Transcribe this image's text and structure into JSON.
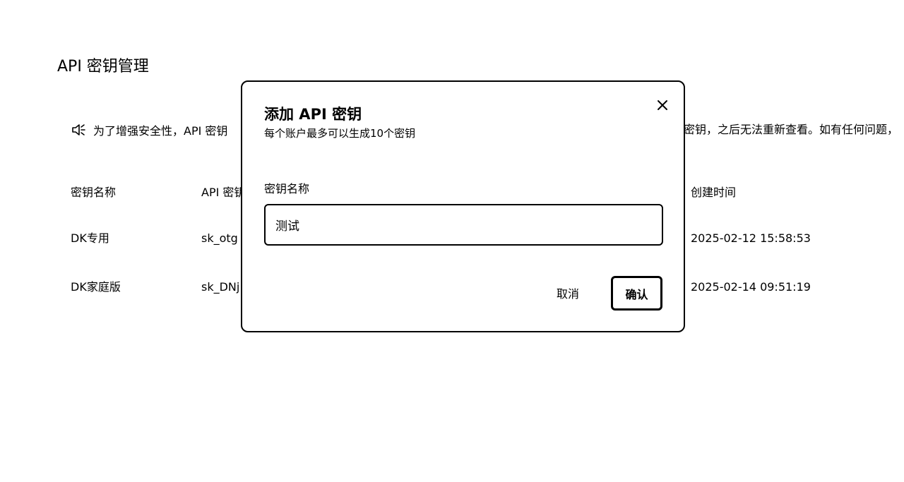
{
  "page": {
    "title": "API 密钥管理"
  },
  "notice": {
    "icon": "speaker-icon",
    "text_left": "为了增强安全性，API 密钥",
    "text_right": "密钥，之后无法重新查看。如有任何问题，"
  },
  "table": {
    "headers": {
      "name": "密钥名称",
      "key": "API 密钥",
      "created": "创建时间"
    },
    "rows": [
      {
        "name": "DK专用",
        "key": "sk_otg",
        "created": "2025-02-12 15:58:53"
      },
      {
        "name": "DK家庭版",
        "key": "sk_DNj",
        "created": "2025-02-14 09:51:19"
      }
    ]
  },
  "modal": {
    "title": "添加 API 密钥",
    "subtitle": "每个账户最多可以生成10个密钥",
    "close_icon": "close-icon",
    "field_label": "密钥名称",
    "input_value": "测试",
    "cancel_label": "取消",
    "confirm_label": "确认"
  }
}
